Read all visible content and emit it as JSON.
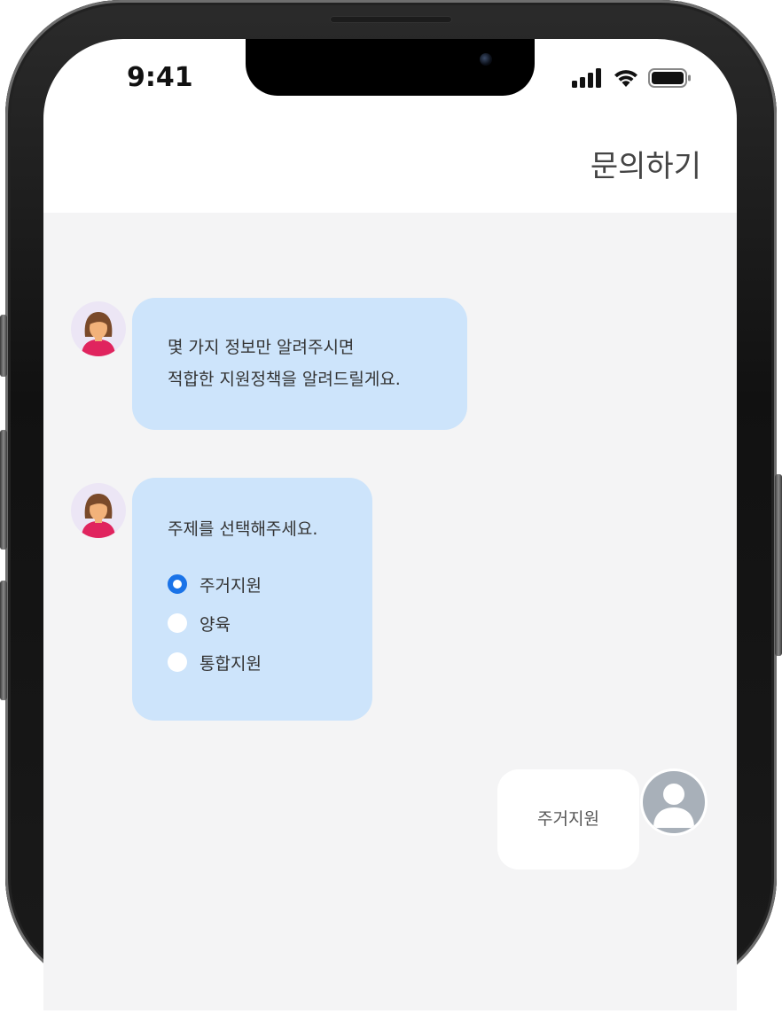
{
  "status_bar": {
    "time": "9:41"
  },
  "header": {
    "title": "문의하기"
  },
  "messages": {
    "bot_intro": {
      "line1": "몇 가지 정보만 알려주시면",
      "line2": "적합한 지원정책을 알려드릴게요."
    },
    "bot_topic": {
      "prompt": "주제를 선택해주세요.",
      "options": [
        {
          "label": "주거지원",
          "selected": true
        },
        {
          "label": "양육",
          "selected": false
        },
        {
          "label": "통합지원",
          "selected": false
        }
      ]
    },
    "user_reply": {
      "text": "주거지원"
    }
  },
  "colors": {
    "bot_bubble": "#cde4fb",
    "accent": "#1a73e8",
    "chat_background": "#f4f4f5"
  }
}
